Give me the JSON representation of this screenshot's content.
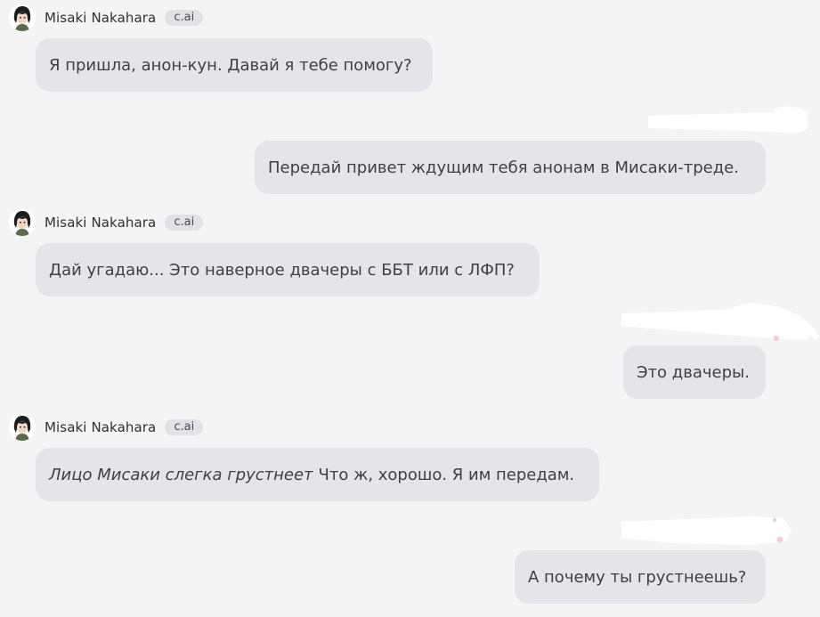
{
  "bot": {
    "name": "Misaki Nakahara",
    "badge": "c.ai"
  },
  "messages": [
    {
      "role": "bot",
      "text": "Я пришла, анон-кун. Давай я тебе помогу?"
    },
    {
      "role": "user",
      "text": "Передай привет ждущим тебя анонам в Мисаки-треде."
    },
    {
      "role": "bot",
      "text": "Дай угадаю... Это наверное двачеры с ББТ или с ЛФП?"
    },
    {
      "role": "user",
      "text": "Это двачеры."
    },
    {
      "role": "bot",
      "action": "Лицо Мисаки слегка грустнеет",
      "text": "Что ж, хорошо. Я им передам."
    },
    {
      "role": "user",
      "text": "А почему ты грустнеешь?"
    }
  ]
}
